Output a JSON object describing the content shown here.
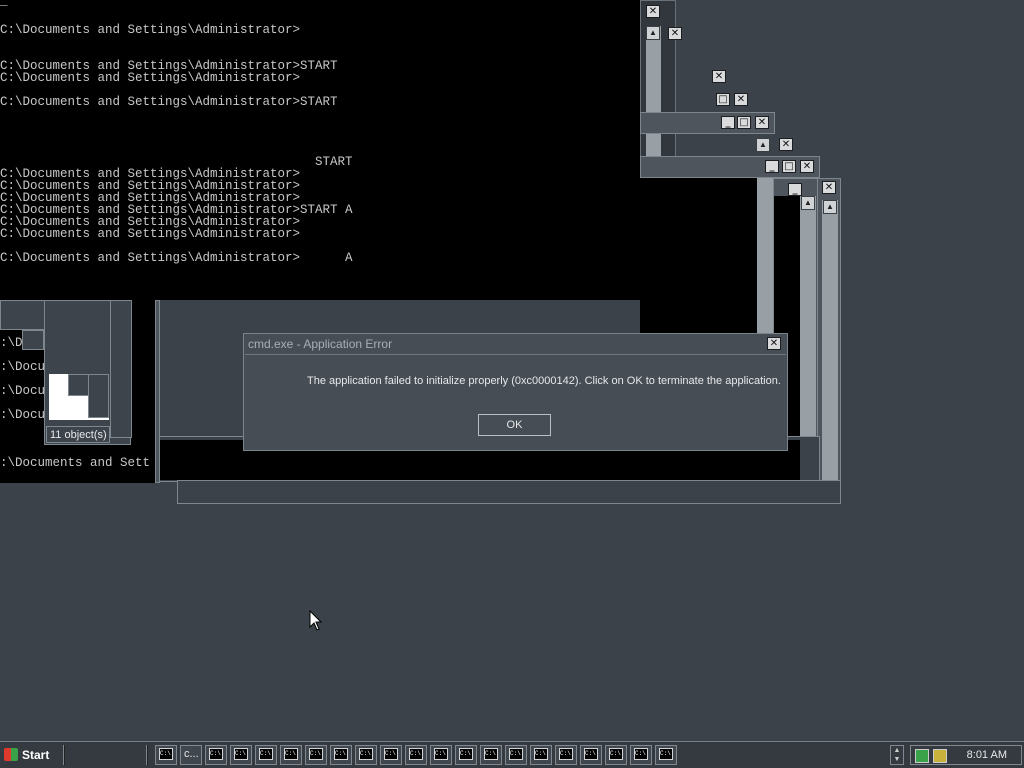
{
  "console": {
    "cursor": "_",
    "lines": [
      "C:\\Documents and Settings\\Administrator>",
      "C:\\Documents and Settings\\Administrator>START",
      "C:\\Documents and Settings\\Administrator>",
      "C:\\Documents and Settings\\Administrator>START",
      "                                          START",
      "C:\\Documents and Settings\\Administrator>",
      "C:\\Documents and Settings\\Administrator>",
      "C:\\Documents and Settings\\Administrator>",
      "C:\\Documents and Settings\\Administrator>START A",
      "C:\\Documents and Settings\\Administrator>",
      "C:\\Documents and Settings\\Administrator>",
      "C:\\Documents and Settings\\Administrator>      A"
    ],
    "partial_lines": [
      ":\\D",
      ":\\Docu",
      ":\\Docu",
      ":\\Docu",
      ":\\Documents and Sett"
    ]
  },
  "explorer_status": "11 object(s)",
  "dialog": {
    "title": "cmd.exe - Application Error",
    "message": "The application failed to initialize properly (0xc0000142). Click on OK to terminate the application.",
    "ok_label": "OK"
  },
  "taskbar": {
    "start_label": "Start",
    "task_icon_text": "C:\\",
    "second_task_label": "c...",
    "clock": "8:01 AM",
    "task_count": 21
  }
}
